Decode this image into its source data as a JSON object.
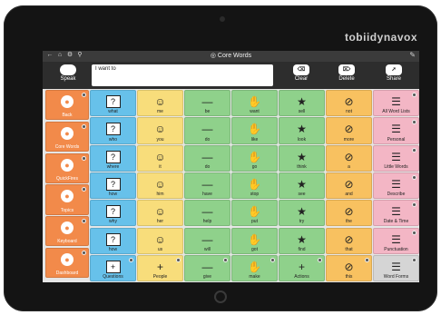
{
  "device": {
    "brand": "tobiidynavox"
  },
  "topbar": {
    "title": "Core Words",
    "title_icon": "target-icon"
  },
  "message": {
    "text": "I want to"
  },
  "buttons": {
    "speak": "Speak",
    "clear": "Clear",
    "delete": "Delete",
    "share": "Share"
  },
  "nav": [
    {
      "label": "Back",
      "icon": "back-arrow-icon"
    },
    {
      "label": "Core Words",
      "icon": "core-target-icon"
    },
    {
      "label": "QuickFires",
      "icon": "flame-icon"
    },
    {
      "label": "Topics",
      "icon": "speech-bubble-icon"
    },
    {
      "label": "Keyboard",
      "icon": "keyboard-icon"
    },
    {
      "label": "Dashboard",
      "icon": "dashboard-icon"
    }
  ],
  "grid": [
    [
      "what",
      "me",
      "be",
      "want",
      "sell",
      "not",
      "All Word Lists"
    ],
    [
      "who",
      "you",
      "do",
      "like",
      "look",
      "more",
      "Personal"
    ],
    [
      "where",
      "it",
      "do",
      "go",
      "think",
      "a",
      "Little Words"
    ],
    [
      "how",
      "him",
      "have",
      "stop",
      "see",
      "and",
      "Describe"
    ],
    [
      "why",
      "her",
      "help",
      "put",
      "try",
      "the",
      "Date & Time"
    ],
    [
      "how",
      "us",
      "will",
      "got",
      "find",
      "that",
      "Punctuation"
    ],
    [
      "Questions",
      "People",
      "give",
      "make",
      "Actions",
      "this",
      "Word Forms"
    ]
  ],
  "colors": {
    "nav": "#f28a4a",
    "questions": "#67c1ea",
    "people": "#f8dd7b",
    "actions": "#8fd18b",
    "little": "#f8c160",
    "lists": "#f3b6c5"
  }
}
